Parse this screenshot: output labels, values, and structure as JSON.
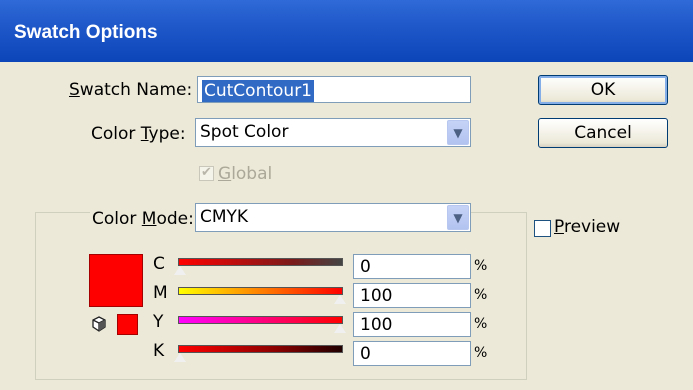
{
  "window": {
    "title": "Swatch Options"
  },
  "form": {
    "swatch_name_label_pre": "",
    "swatch_name_label_u": "S",
    "swatch_name_label_post": "watch Name:",
    "swatch_name_value": "CutContour1",
    "color_type_label_pre": "Color ",
    "color_type_label_u": "T",
    "color_type_label_post": "ype:",
    "color_type_value": "Spot Color",
    "global_label_pre": "",
    "global_label_u": "G",
    "global_label_post": "lobal",
    "color_mode_label_pre": "Color ",
    "color_mode_label_u": "M",
    "color_mode_label_post": "ode:",
    "color_mode_value": "CMYK"
  },
  "buttons": {
    "ok": "OK",
    "cancel": "Cancel"
  },
  "preview": {
    "label_u": "P",
    "label_post": "review"
  },
  "channels": [
    {
      "letter": "C",
      "value": "0",
      "unit": "%"
    },
    {
      "letter": "M",
      "value": "100",
      "unit": "%"
    },
    {
      "letter": "Y",
      "value": "100",
      "unit": "%"
    },
    {
      "letter": "K",
      "value": "0",
      "unit": "%"
    }
  ],
  "colors": {
    "swatch": "#ff0000",
    "title_bar": "#0b45b8"
  },
  "icons": {
    "gamut": "cube-icon"
  }
}
